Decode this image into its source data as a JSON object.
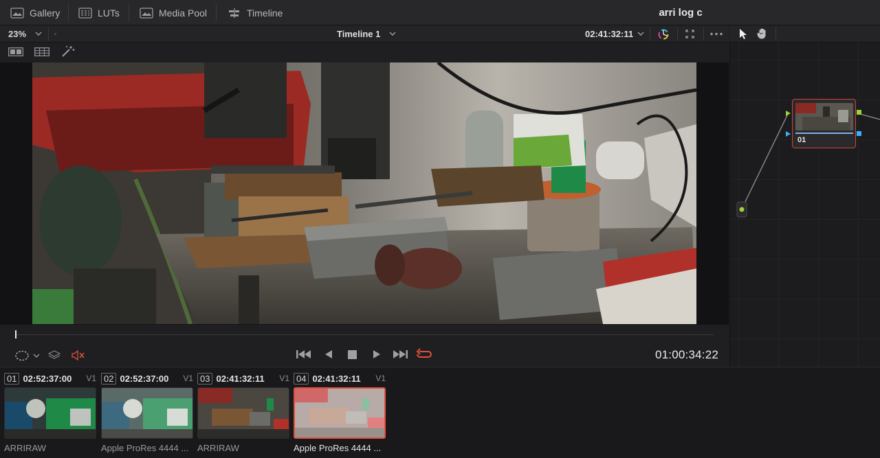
{
  "topbar": {
    "gallery": "Gallery",
    "luts": "LUTs",
    "media_pool": "Media Pool",
    "timeline": "Timeline",
    "project_title": "arri log c"
  },
  "viewer_bar": {
    "zoom": "23%",
    "timeline_name": "Timeline 1",
    "source_timecode": "02:41:32:11"
  },
  "transport": {
    "timecode": "01:00:34:22"
  },
  "clips": [
    {
      "num": "01",
      "tc": "02:52:37:00",
      "track": "V1",
      "name": "ARRIRAW",
      "selected": false
    },
    {
      "num": "02",
      "tc": "02:52:37:00",
      "track": "V1",
      "name": "Apple ProRes 4444 ...",
      "selected": false
    },
    {
      "num": "03",
      "tc": "02:41:32:11",
      "track": "V1",
      "name": "ARRIRAW",
      "selected": false
    },
    {
      "num": "04",
      "tc": "02:41:32:11",
      "track": "V1",
      "name": "Apple ProRes 4444 ...",
      "selected": true
    }
  ],
  "node": {
    "label": "01"
  },
  "colors": {
    "accent_red": "#e0503c",
    "node_input_green": "#9fd433",
    "node_output_blue": "#3ab0ff"
  }
}
